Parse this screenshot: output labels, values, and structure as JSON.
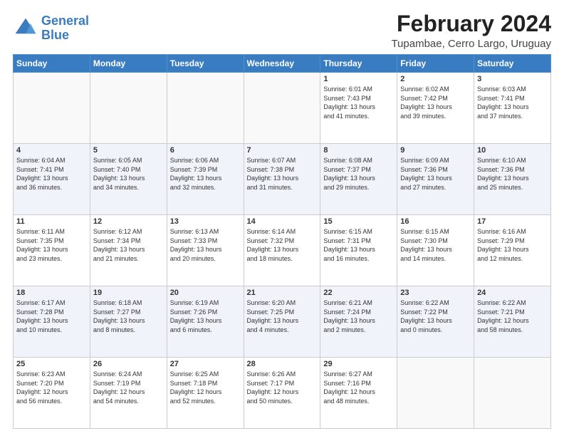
{
  "header": {
    "logo_line1": "General",
    "logo_line2": "Blue",
    "title": "February 2024",
    "subtitle": "Tupambae, Cerro Largo, Uruguay"
  },
  "calendar": {
    "days_of_week": [
      "Sunday",
      "Monday",
      "Tuesday",
      "Wednesday",
      "Thursday",
      "Friday",
      "Saturday"
    ],
    "weeks": [
      [
        {
          "day": "",
          "info": ""
        },
        {
          "day": "",
          "info": ""
        },
        {
          "day": "",
          "info": ""
        },
        {
          "day": "",
          "info": ""
        },
        {
          "day": "1",
          "info": "Sunrise: 6:01 AM\nSunset: 7:43 PM\nDaylight: 13 hours\nand 41 minutes."
        },
        {
          "day": "2",
          "info": "Sunrise: 6:02 AM\nSunset: 7:42 PM\nDaylight: 13 hours\nand 39 minutes."
        },
        {
          "day": "3",
          "info": "Sunrise: 6:03 AM\nSunset: 7:41 PM\nDaylight: 13 hours\nand 37 minutes."
        }
      ],
      [
        {
          "day": "4",
          "info": "Sunrise: 6:04 AM\nSunset: 7:41 PM\nDaylight: 13 hours\nand 36 minutes."
        },
        {
          "day": "5",
          "info": "Sunrise: 6:05 AM\nSunset: 7:40 PM\nDaylight: 13 hours\nand 34 minutes."
        },
        {
          "day": "6",
          "info": "Sunrise: 6:06 AM\nSunset: 7:39 PM\nDaylight: 13 hours\nand 32 minutes."
        },
        {
          "day": "7",
          "info": "Sunrise: 6:07 AM\nSunset: 7:38 PM\nDaylight: 13 hours\nand 31 minutes."
        },
        {
          "day": "8",
          "info": "Sunrise: 6:08 AM\nSunset: 7:37 PM\nDaylight: 13 hours\nand 29 minutes."
        },
        {
          "day": "9",
          "info": "Sunrise: 6:09 AM\nSunset: 7:36 PM\nDaylight: 13 hours\nand 27 minutes."
        },
        {
          "day": "10",
          "info": "Sunrise: 6:10 AM\nSunset: 7:36 PM\nDaylight: 13 hours\nand 25 minutes."
        }
      ],
      [
        {
          "day": "11",
          "info": "Sunrise: 6:11 AM\nSunset: 7:35 PM\nDaylight: 13 hours\nand 23 minutes."
        },
        {
          "day": "12",
          "info": "Sunrise: 6:12 AM\nSunset: 7:34 PM\nDaylight: 13 hours\nand 21 minutes."
        },
        {
          "day": "13",
          "info": "Sunrise: 6:13 AM\nSunset: 7:33 PM\nDaylight: 13 hours\nand 20 minutes."
        },
        {
          "day": "14",
          "info": "Sunrise: 6:14 AM\nSunset: 7:32 PM\nDaylight: 13 hours\nand 18 minutes."
        },
        {
          "day": "15",
          "info": "Sunrise: 6:15 AM\nSunset: 7:31 PM\nDaylight: 13 hours\nand 16 minutes."
        },
        {
          "day": "16",
          "info": "Sunrise: 6:15 AM\nSunset: 7:30 PM\nDaylight: 13 hours\nand 14 minutes."
        },
        {
          "day": "17",
          "info": "Sunrise: 6:16 AM\nSunset: 7:29 PM\nDaylight: 13 hours\nand 12 minutes."
        }
      ],
      [
        {
          "day": "18",
          "info": "Sunrise: 6:17 AM\nSunset: 7:28 PM\nDaylight: 13 hours\nand 10 minutes."
        },
        {
          "day": "19",
          "info": "Sunrise: 6:18 AM\nSunset: 7:27 PM\nDaylight: 13 hours\nand 8 minutes."
        },
        {
          "day": "20",
          "info": "Sunrise: 6:19 AM\nSunset: 7:26 PM\nDaylight: 13 hours\nand 6 minutes."
        },
        {
          "day": "21",
          "info": "Sunrise: 6:20 AM\nSunset: 7:25 PM\nDaylight: 13 hours\nand 4 minutes."
        },
        {
          "day": "22",
          "info": "Sunrise: 6:21 AM\nSunset: 7:24 PM\nDaylight: 13 hours\nand 2 minutes."
        },
        {
          "day": "23",
          "info": "Sunrise: 6:22 AM\nSunset: 7:22 PM\nDaylight: 13 hours\nand 0 minutes."
        },
        {
          "day": "24",
          "info": "Sunrise: 6:22 AM\nSunset: 7:21 PM\nDaylight: 12 hours\nand 58 minutes."
        }
      ],
      [
        {
          "day": "25",
          "info": "Sunrise: 6:23 AM\nSunset: 7:20 PM\nDaylight: 12 hours\nand 56 minutes."
        },
        {
          "day": "26",
          "info": "Sunrise: 6:24 AM\nSunset: 7:19 PM\nDaylight: 12 hours\nand 54 minutes."
        },
        {
          "day": "27",
          "info": "Sunrise: 6:25 AM\nSunset: 7:18 PM\nDaylight: 12 hours\nand 52 minutes."
        },
        {
          "day": "28",
          "info": "Sunrise: 6:26 AM\nSunset: 7:17 PM\nDaylight: 12 hours\nand 50 minutes."
        },
        {
          "day": "29",
          "info": "Sunrise: 6:27 AM\nSunset: 7:16 PM\nDaylight: 12 hours\nand 48 minutes."
        },
        {
          "day": "",
          "info": ""
        },
        {
          "day": "",
          "info": ""
        }
      ]
    ]
  }
}
